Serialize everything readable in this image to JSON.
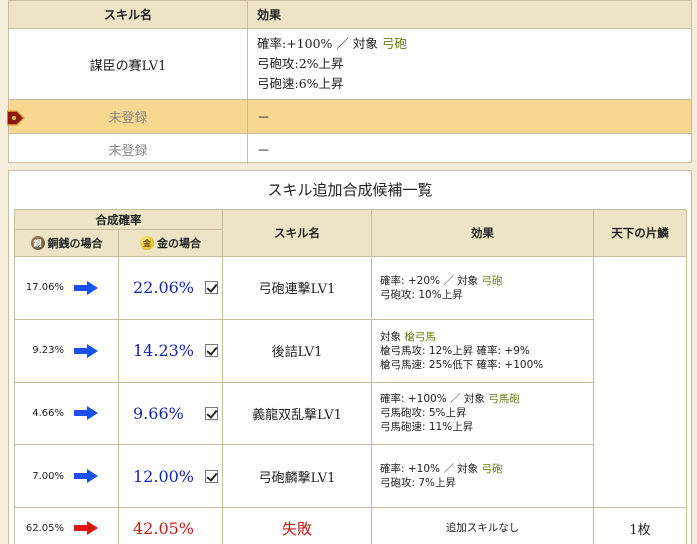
{
  "top_table": {
    "header": {
      "name": "スキル名",
      "effect": "効果"
    },
    "row1": {
      "name": "謀臣の賽LV1",
      "effect_lines": [
        {
          "text": "確率:+100% ／ 対象 ",
          "target": "弓砲"
        },
        {
          "text": "弓砲攻:2%上昇",
          "target": ""
        },
        {
          "text": "弓砲速:6%上昇",
          "target": ""
        }
      ]
    },
    "row2": {
      "name": "未登録",
      "effect": "－"
    },
    "row3": {
      "name": "未登録",
      "effect": "－"
    }
  },
  "panel": {
    "title": "スキル追加合成候補一覧",
    "headers": {
      "rate": "合成確率",
      "copper": "銅銭の場合",
      "gold": "金の場合",
      "skill": "スキル名",
      "effect": "効果",
      "tenka": "天下の片鱗",
      "copper_coin": "銅",
      "gold_coin": "金"
    },
    "rows": [
      {
        "copper": "17.06%",
        "gold": "22.06%",
        "skill": "弓砲連撃LV1",
        "effect_lines": [
          {
            "text": "確率: +20% ／ 対象 ",
            "target": "弓砲"
          },
          {
            "text": "弓砲攻: 10%上昇",
            "target": ""
          }
        ]
      },
      {
        "copper": "9.23%",
        "gold": "14.23%",
        "skill": "後詰LV1",
        "effect_lines": [
          {
            "text": "対象 ",
            "target": "槍弓馬"
          },
          {
            "text": "槍弓馬攻: 12%上昇 確率: +9%",
            "target": ""
          },
          {
            "text": "槍弓馬速: 25%低下 確率: +100%",
            "target": ""
          }
        ]
      },
      {
        "copper": "4.66%",
        "gold": "9.66%",
        "skill": "義龍双乱撃LV1",
        "effect_lines": [
          {
            "text": "確率: +100% ／ 対象 ",
            "target": "弓馬砲"
          },
          {
            "text": "弓馬砲攻: 5%上昇",
            "target": ""
          },
          {
            "text": "弓馬砲速: 11%上昇",
            "target": ""
          }
        ]
      },
      {
        "copper": "7.00%",
        "gold": "12.00%",
        "skill": "弓砲麟撃LV1",
        "effect_lines": [
          {
            "text": "確率: +10% ／ 対象 ",
            "target": "弓砲"
          },
          {
            "text": "弓砲攻: 7%上昇",
            "target": ""
          }
        ]
      }
    ],
    "fail_row": {
      "copper": "62.05%",
      "gold": "42.05%",
      "skill": "失敗",
      "effect": "追加スキルなし",
      "tenka": "1枚"
    }
  },
  "colors": {
    "background": "#f3edd9",
    "header_bg": "#ede4c6",
    "highlight_row": "#f8d890",
    "border": "#c9bd9c",
    "target_green": "#6c7a16",
    "gold_value_blue": "#1427a8",
    "fail_red": "#c81a14",
    "arrow_blue": "#1a4ff0",
    "arrow_red": "#e0140a"
  }
}
